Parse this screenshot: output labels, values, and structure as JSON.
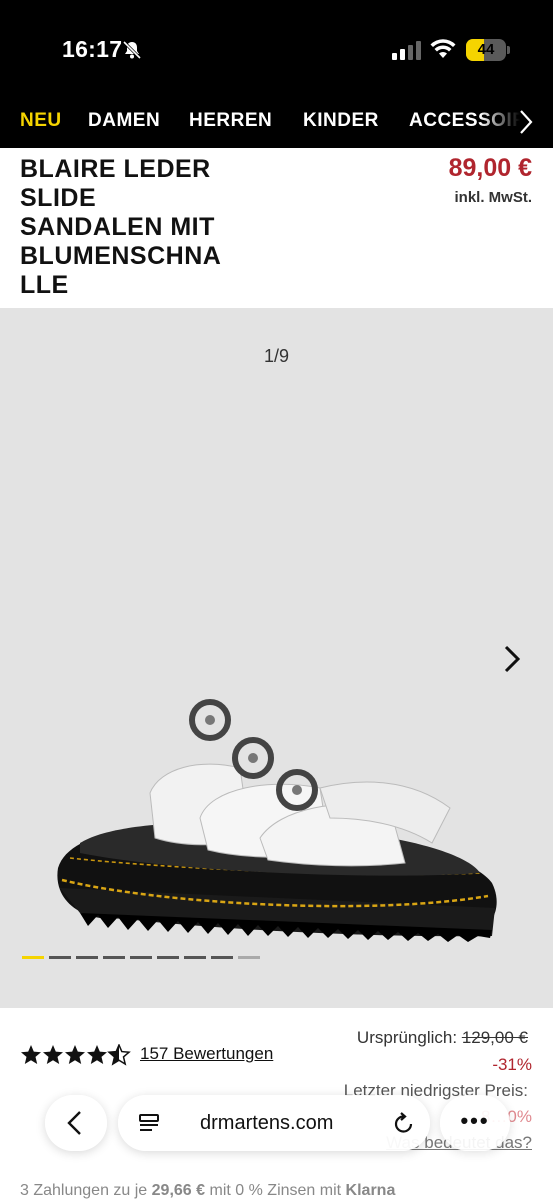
{
  "status_bar": {
    "time": "16:17",
    "battery": "44",
    "battery_level": 0.44
  },
  "nav": {
    "items": [
      "NEU",
      "DAMEN",
      "HERREN",
      "KINDER",
      "ACCESSOIRES"
    ]
  },
  "product": {
    "title_lines": [
      "BLAIRE LEDER",
      "SLIDE",
      "SANDALEN MIT",
      "BLUMENSCHNA",
      "LLE"
    ],
    "price": "89,00 €",
    "vat_note": "inkl. MwSt."
  },
  "gallery": {
    "counter": "1/9",
    "dots_count": 9,
    "active_dot": 0
  },
  "rating": {
    "value": 4.5,
    "reviews": "157 Bewertungen"
  },
  "pricing": {
    "original_label": "Ursprünglich:",
    "original_price": "129,00 €",
    "discount": "-31%",
    "lowest_label": "Letzter niedrigster Preis:",
    "lowest_value": "8…0%",
    "question": "Was bedeutet das?"
  },
  "klarna": {
    "prefix": "3 Zahlungen zu je",
    "amount": "29,66 €",
    "suffix": "mit 0 % Zinsen mit",
    "brand": "Klarna"
  },
  "browser": {
    "url": "drmartens.com"
  },
  "colors": {
    "accent": "#f5d400",
    "sale": "#b0252e",
    "nav_bg": "#000000",
    "gallery_bg": "#e3e3e3"
  }
}
